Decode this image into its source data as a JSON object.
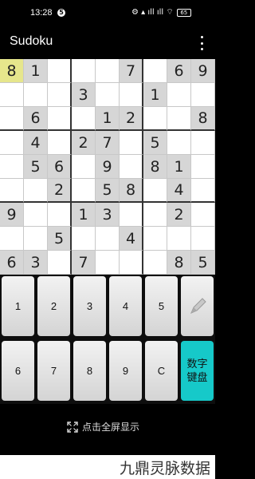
{
  "status_bar": {
    "time": "13:28",
    "notif": "5",
    "signal": "⚙ ▴ ıll ıll ⌔",
    "battery": "65"
  },
  "app_bar": {
    "title": "Sudoku"
  },
  "grid": {
    "selected": [
      0,
      0
    ],
    "rows": [
      [
        "8",
        "1",
        "",
        "",
        "",
        "7",
        "",
        "6",
        "9"
      ],
      [
        "",
        "",
        "",
        "3",
        "",
        "",
        "1",
        "",
        ""
      ],
      [
        "",
        "6",
        "",
        "",
        "1",
        "2",
        "",
        "",
        "8"
      ],
      [
        "",
        "4",
        "",
        "2",
        "7",
        "",
        "5",
        "",
        ""
      ],
      [
        "",
        "5",
        "6",
        "",
        "9",
        "",
        "8",
        "1",
        ""
      ],
      [
        "",
        "",
        "2",
        "",
        "5",
        "8",
        "",
        "4",
        ""
      ],
      [
        "9",
        "",
        "",
        "1",
        "3",
        "",
        "",
        "2",
        ""
      ],
      [
        "",
        "",
        "5",
        "",
        "",
        "4",
        "",
        "",
        ""
      ],
      [
        "6",
        "3",
        "",
        "7",
        "",
        "",
        "",
        "8",
        "5"
      ]
    ]
  },
  "keypad": {
    "row1": [
      "1",
      "2",
      "3",
      "4",
      "5"
    ],
    "row2": [
      "6",
      "7",
      "8",
      "9",
      "C"
    ],
    "numeric_keyboard_line1": "数字",
    "numeric_keyboard_line2": "键盘",
    "pencil_icon": "pencil-icon",
    "teal_color": "#16c9c9"
  },
  "bottom": {
    "fullscreen_label": "点击全屏显示",
    "fullscreen_icon": "expand-icon"
  },
  "watermark": {
    "text": "九鼎灵脉数据"
  }
}
